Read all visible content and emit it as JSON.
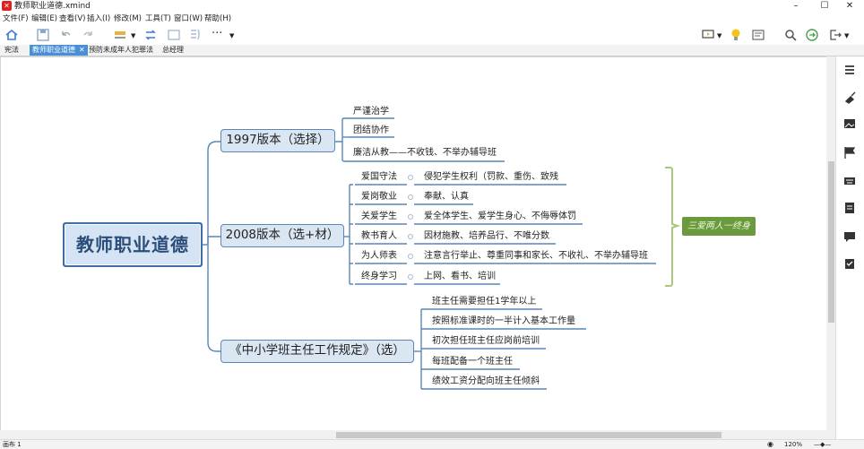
{
  "window": {
    "title": "教师职业道德.xmind"
  },
  "menu": [
    "文件(F)",
    "编辑(E)",
    "查看(V)",
    "插入(I)",
    "修改(M)",
    "工具(T)",
    "窗口(W)",
    "帮助(H)"
  ],
  "tabs": [
    {
      "label": "宪法",
      "active": false
    },
    {
      "label": "教师职业道德",
      "active": true
    },
    {
      "label": "预防未成年人犯罪法",
      "active": false
    },
    {
      "label": "总经理",
      "active": false
    }
  ],
  "mindmap": {
    "central": "教师职业道德",
    "branch1": {
      "label": "1997版本（选择）",
      "items": [
        "严谨治学",
        "团结协作",
        "廉洁从教——不收钱、不举办辅导班"
      ]
    },
    "branch2": {
      "label": "2008版本（选+材）",
      "rows": [
        {
          "key": "爱国守法",
          "value": "侵犯学生权利（罚款、重伤、致残"
        },
        {
          "key": "爱岗敬业",
          "value": "奉献、认真"
        },
        {
          "key": "关爱学生",
          "value": "爱全体学生、爱学生身心、不侮辱体罚"
        },
        {
          "key": "教书育人",
          "value": "因材施教、培养品行、不唯分数"
        },
        {
          "key": "为人师表",
          "value": "注意言行举止、尊重同事和家长、不收礼、不举办辅导班"
        },
        {
          "key": "终身学习",
          "value": "上网、看书、培训"
        }
      ],
      "summary": "三爱两人一终身"
    },
    "branch3": {
      "label": "《中小学班主任工作规定》（选）",
      "items": [
        "班主任需要担任1学年以上",
        "按照标准课时的一半计入基本工作量",
        "初次担任班主任应岗前培训",
        "每班配备一个班主任",
        "绩效工资分配向班主任倾斜"
      ]
    }
  },
  "status": {
    "left": "画布 1",
    "zoom": "120%"
  },
  "colors": {
    "central_border": "#3f6fa6",
    "node_fill": "#dbe6f3",
    "connector": "#5a86b8",
    "summary_bracket": "#a8c87a",
    "summary_fill": "#6a9a3c",
    "tab_active": "#4a8fd6"
  }
}
